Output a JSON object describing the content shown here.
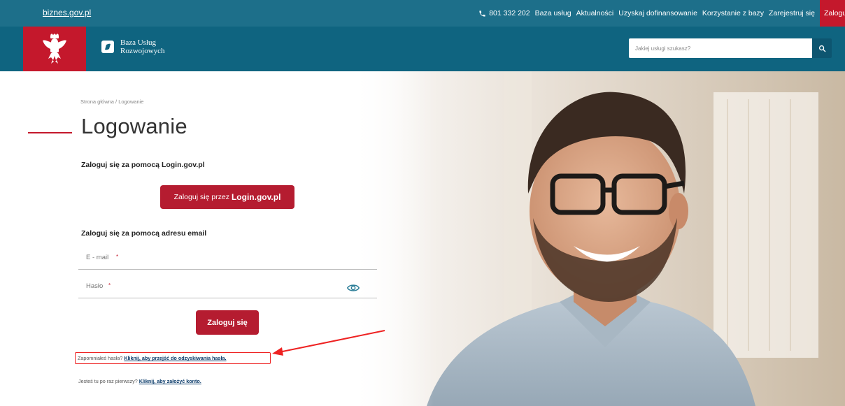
{
  "topbar": {
    "site": "biznes.gov.pl",
    "phone": "801 332 202",
    "links": [
      "Baza usług",
      "Aktualności",
      "Uzyskaj dofinansowanie",
      "Korzystanie z bazy",
      "Zarejestruj się"
    ],
    "login": "Zaloguj"
  },
  "header": {
    "brand_line1": "Baza Usług",
    "brand_line2": "Rozwojowych",
    "search_placeholder": "Jakiej usługi szukasz?"
  },
  "breadcrumb": "Strona główna / Logowanie",
  "page_title": "Logowanie",
  "login_gov": {
    "heading": "Zaloguj się za pomocą Login.gov.pl",
    "button_prefix": "Zaloguj się przez",
    "button_bold": "Login.gov.pl"
  },
  "email_login": {
    "heading": "Zaloguj się za pomocą adresu email",
    "email_placeholder": "E - mail",
    "password_placeholder": "Hasło",
    "required_mark": "*",
    "submit": "Zaloguj się"
  },
  "forgot": {
    "text": "Zapomniałeś hasła?",
    "link": "Kliknij, aby przejść do odzyskiwania hasła."
  },
  "new_account": {
    "text": "Jesteś tu po raz pierwszy?",
    "link": "Kliknij, aby założyć konto."
  },
  "colors": {
    "topbar": "#1d6f8a",
    "header": "#0f6480",
    "accent_red": "#c4182c",
    "button_red": "#b51c30"
  }
}
